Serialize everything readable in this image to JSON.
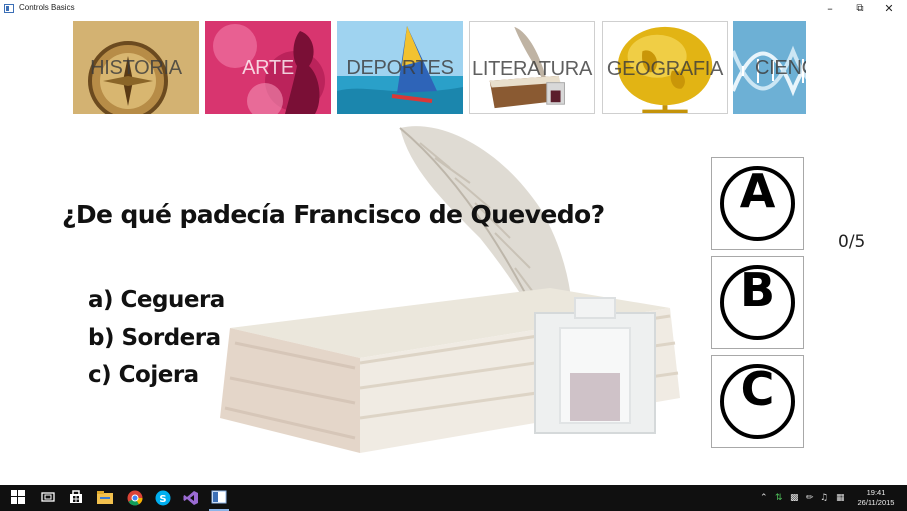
{
  "window": {
    "title": "Controls Basics"
  },
  "categories": [
    {
      "label": "HISTORIA"
    },
    {
      "label": "ARTE"
    },
    {
      "label": "DEPORTES"
    },
    {
      "label": "LITERATURA"
    },
    {
      "label": "GEOGRAFIA"
    },
    {
      "label": "CIENC"
    }
  ],
  "question": {
    "text": "¿De qué padecía Francisco de Quevedo?",
    "options": [
      {
        "text": "a) Ceguera"
      },
      {
        "text": "b) Sordera"
      },
      {
        "text": "c) Cojera"
      }
    ]
  },
  "answers": [
    {
      "letter": "A"
    },
    {
      "letter": "B"
    },
    {
      "letter": "C"
    }
  ],
  "score": "0/5",
  "taskbar": {
    "apps": [
      "windows-start-icon",
      "task-view-icon",
      "store-icon",
      "file-explorer-icon",
      "chrome-icon",
      "skype-icon",
      "visual-studio-icon",
      "controls-basics-app-icon"
    ],
    "clock_time": "19:41",
    "clock_date": "26/11/2015"
  }
}
